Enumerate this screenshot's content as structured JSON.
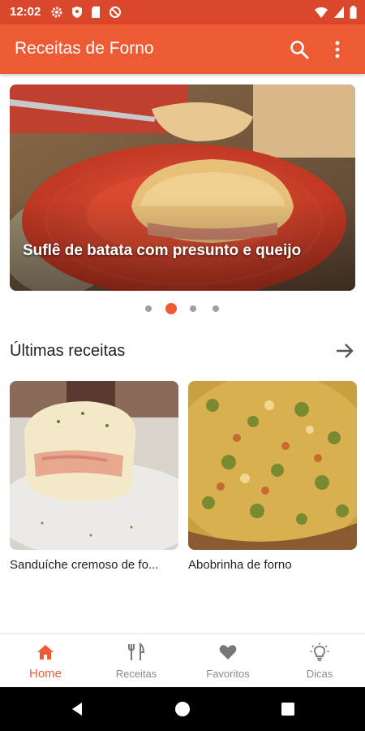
{
  "status": {
    "time": "12:02"
  },
  "appbar": {
    "title": "Receitas de Forno",
    "search_icon": "search-icon",
    "more_icon": "more-vert-icon"
  },
  "hero": {
    "caption": "Suflê de batata com presunto e queijo",
    "active_slide": 2,
    "slide_count": 4
  },
  "latest": {
    "title": "Últimas receitas",
    "items": [
      {
        "label": "Sanduíche cremoso de fo..."
      },
      {
        "label": "Abobrinha de forno"
      }
    ]
  },
  "bottom_nav": {
    "items": [
      {
        "label": "Home",
        "icon": "home-icon",
        "active": true
      },
      {
        "label": "Receitas",
        "icon": "fork-knife-icon",
        "active": false
      },
      {
        "label": "Favoritos",
        "icon": "heart-icon",
        "active": false
      },
      {
        "label": "Dicas",
        "icon": "lightbulb-icon",
        "active": false
      }
    ]
  },
  "colors": {
    "primary": "#ed5b35",
    "status_bar": "#d9482a",
    "inactive": "#8a8a8a"
  }
}
